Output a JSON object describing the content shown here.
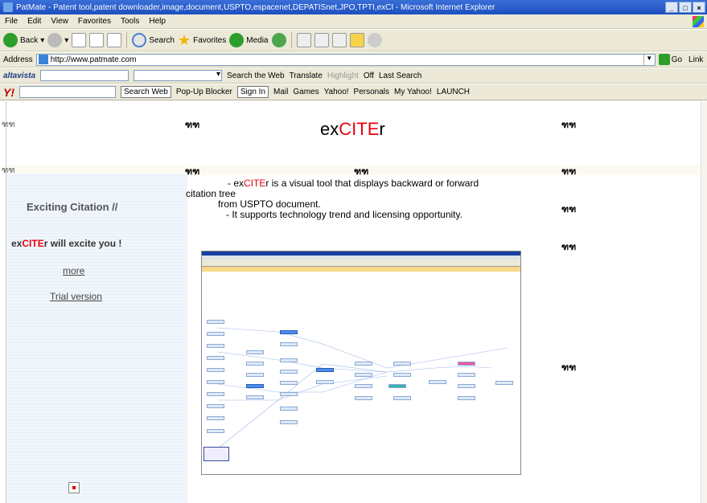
{
  "window": {
    "title": "PatMate - Patent tool,patent downloader,image,document,USPTO,espacenet,DEPATISnet,JPO,TPTI,exCI - Microsoft Internet Explorer",
    "buttons": [
      "_",
      "□",
      "×"
    ]
  },
  "menu": [
    "File",
    "Edit",
    "View",
    "Favorites",
    "Tools",
    "Help"
  ],
  "toolbar": {
    "back": "Back",
    "search": "Search",
    "favorites": "Favorites",
    "media": "Media"
  },
  "address": {
    "label": "Address",
    "url": "http://www.patmate.com",
    "go": "Go",
    "links": "Link"
  },
  "altavista": {
    "logo": "altavista",
    "search_web": "Search the Web",
    "translate": "Translate",
    "highlight": "Highlight",
    "off": "Off",
    "last_search": "Last Search"
  },
  "yahoo": {
    "logo": "Y!",
    "search_web": "Search Web",
    "popup_blocker": "Pop-Up Blocker",
    "sign_in": "Sign In",
    "mail": "Mail",
    "games": "Games",
    "yahoo": "Yahoo!",
    "personals": "Personals",
    "my_yahoo": "My Yahoo!",
    "launch": "LAUNCH"
  },
  "page": {
    "placeholder_tag": "ฑฑ",
    "brand_ex": "ex",
    "brand_cite": "CITE",
    "brand_r": "r",
    "left": {
      "title": "Exciting Citation  //",
      "excite_ex": "ex",
      "excite_cite": "CITE",
      "excite_rest": "r will excite you !",
      "more": "more",
      "trial": "Trial version"
    },
    "desc": {
      "l1_pre": "- ex",
      "l1_cite": "CITE",
      "l1_post": "r is a visual tool that displays backward or forward",
      "l2": "citation tree",
      "l3": "from USPTO document.",
      "l4": "-  It supports technology trend and licensing opportunity."
    }
  }
}
